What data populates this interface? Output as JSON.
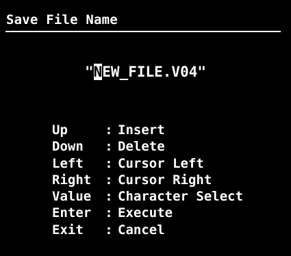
{
  "dialog": {
    "title": "Save File Name"
  },
  "filename": {
    "open_quote": "\"",
    "cursor_char": "N",
    "rest": "EW_FILE.V04",
    "close_quote": "\""
  },
  "help": [
    {
      "key": "Up",
      "sep": ":",
      "action": "Insert"
    },
    {
      "key": "Down",
      "sep": ":",
      "action": "Delete"
    },
    {
      "key": "Left",
      "sep": ":",
      "action": "Cursor Left"
    },
    {
      "key": "Right",
      "sep": ":",
      "action": "Cursor Right"
    },
    {
      "key": "Value",
      "sep": ":",
      "action": "Character Select"
    },
    {
      "key": "Enter",
      "sep": ":",
      "action": "Execute"
    },
    {
      "key": "Exit",
      "sep": ":",
      "action": "Cancel"
    }
  ],
  "colors": {
    "background": "#000000",
    "foreground": "#ffffff"
  }
}
